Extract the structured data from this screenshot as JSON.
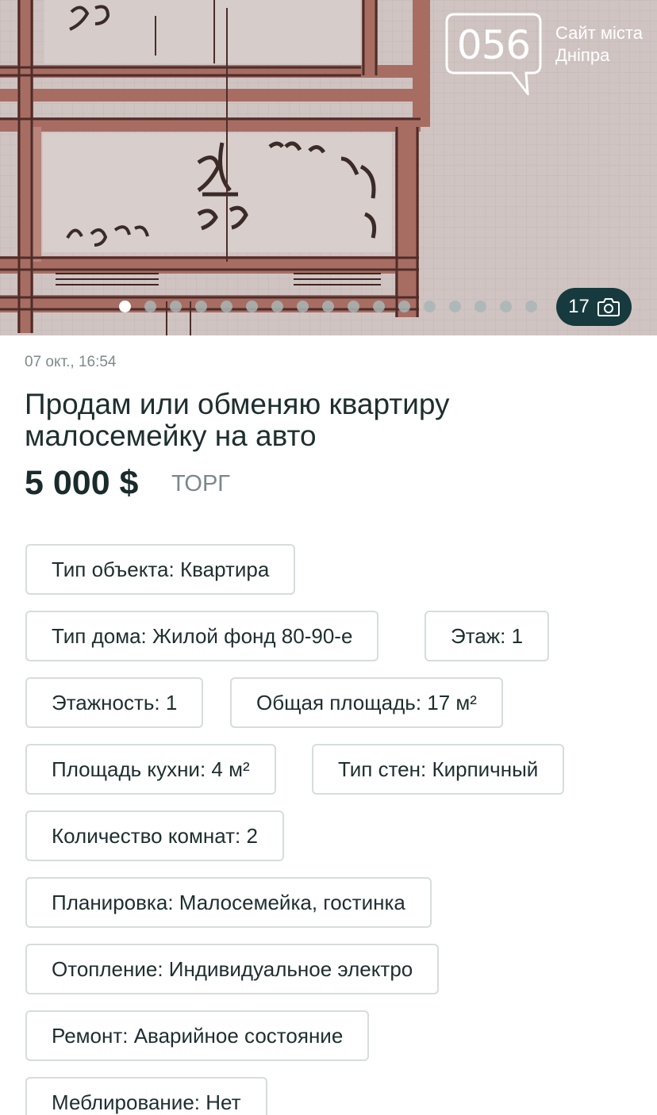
{
  "gallery": {
    "logo_number": "056",
    "logo_caption_line1": "Сайт міста",
    "logo_caption_line2": "Дніпра",
    "photo_count": "17",
    "slide_total": 17,
    "active_slide": 1,
    "camera_icon": "camera-icon"
  },
  "listing": {
    "date": "07 окт., 16:54",
    "title": "Продам или обменяю квартиру малосемейку на авто",
    "price": "5 000 $",
    "negotiable": "ТОРГ"
  },
  "attributes": [
    "Тип объекта: Квартира",
    "Тип дома: Жилой фонд 80-90-е",
    "Этаж: 1",
    "Этажность: 1",
    "Общая площадь: 17 м²",
    "Площадь кухни: 4 м²",
    "Тип стен: Кирпичный",
    "Количество комнат: 2",
    "Планировка: Малосемейка, гостинка",
    "Отопление: Индивидуальное электро",
    "Ремонт: Аварийное состояние",
    "Меблирование: Нет"
  ],
  "colors": {
    "accent": "#163a3d",
    "text": "#1e2e2f",
    "muted": "#7e8a8b",
    "chip_border": "#d7dcdc"
  }
}
